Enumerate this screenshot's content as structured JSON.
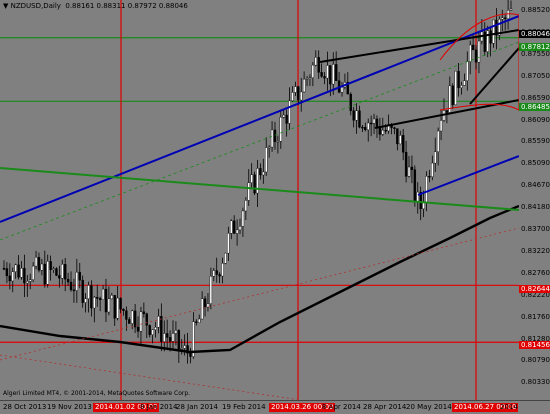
{
  "symbol_info": "▼ NZDUSD,Daily  0.88161 0.88311 0.87972 0.88046",
  "copyright": "Algeri Limited MT4, © 2001-2014, MetaQuotes Software Corp.",
  "price_axis": {
    "ticks": [
      "0.88520",
      "0.87990",
      "0.87550",
      "0.87050",
      "0.86590",
      "0.86090",
      "0.85590",
      "0.85090",
      "0.84670",
      "0.84180",
      "0.83700",
      "0.83220",
      "0.82760",
      "0.82220",
      "0.81760",
      "0.81280",
      "0.80790",
      "0.80330"
    ],
    "tags": [
      {
        "value": "0.88046",
        "color": "#000000",
        "text_color": "#ffffff"
      },
      {
        "value": "0.87812",
        "color": "#1a8a1a",
        "text_color": "#ffffff"
      },
      {
        "value": "0.86485",
        "color": "#1a8a1a",
        "text_color": "#ffffff"
      },
      {
        "value": "0.82644",
        "color": "#e00000",
        "text_color": "#ffffff"
      },
      {
        "value": "0.81456",
        "color": "#e00000",
        "text_color": "#ffffff"
      }
    ]
  },
  "time_axis": {
    "ticks": [
      "28 Oct 2013",
      "19 Nov 2013",
      "2014.01.02 00:00",
      "8 Jan 2014",
      "28 Jan 2014",
      "19 Feb 2014",
      "2014.03.26 00:00",
      "8 Apr 2014",
      "28 Apr 2014",
      "20 May 2014",
      "2014.06.27 00:00",
      "2014"
    ]
  },
  "chart_data": {
    "type": "candlestick",
    "title": "NZDUSD,Daily",
    "open": 0.88161,
    "high": 0.88311,
    "low": 0.87972,
    "close": 0.88046,
    "ylim": [
      0.8025,
      0.886
    ],
    "horizontal_levels": [
      {
        "value": 0.87812,
        "color": "#1a8a1a"
      },
      {
        "value": 0.86485,
        "color": "#1a8a1a"
      },
      {
        "value": 0.82644,
        "color": "#e00000"
      },
      {
        "value": 0.81456,
        "color": "#e00000"
      }
    ],
    "vertical_markers": [
      "2014.01.02 00:00",
      "2014.03.26 00:00",
      "2014.06.27 00:00"
    ]
  }
}
